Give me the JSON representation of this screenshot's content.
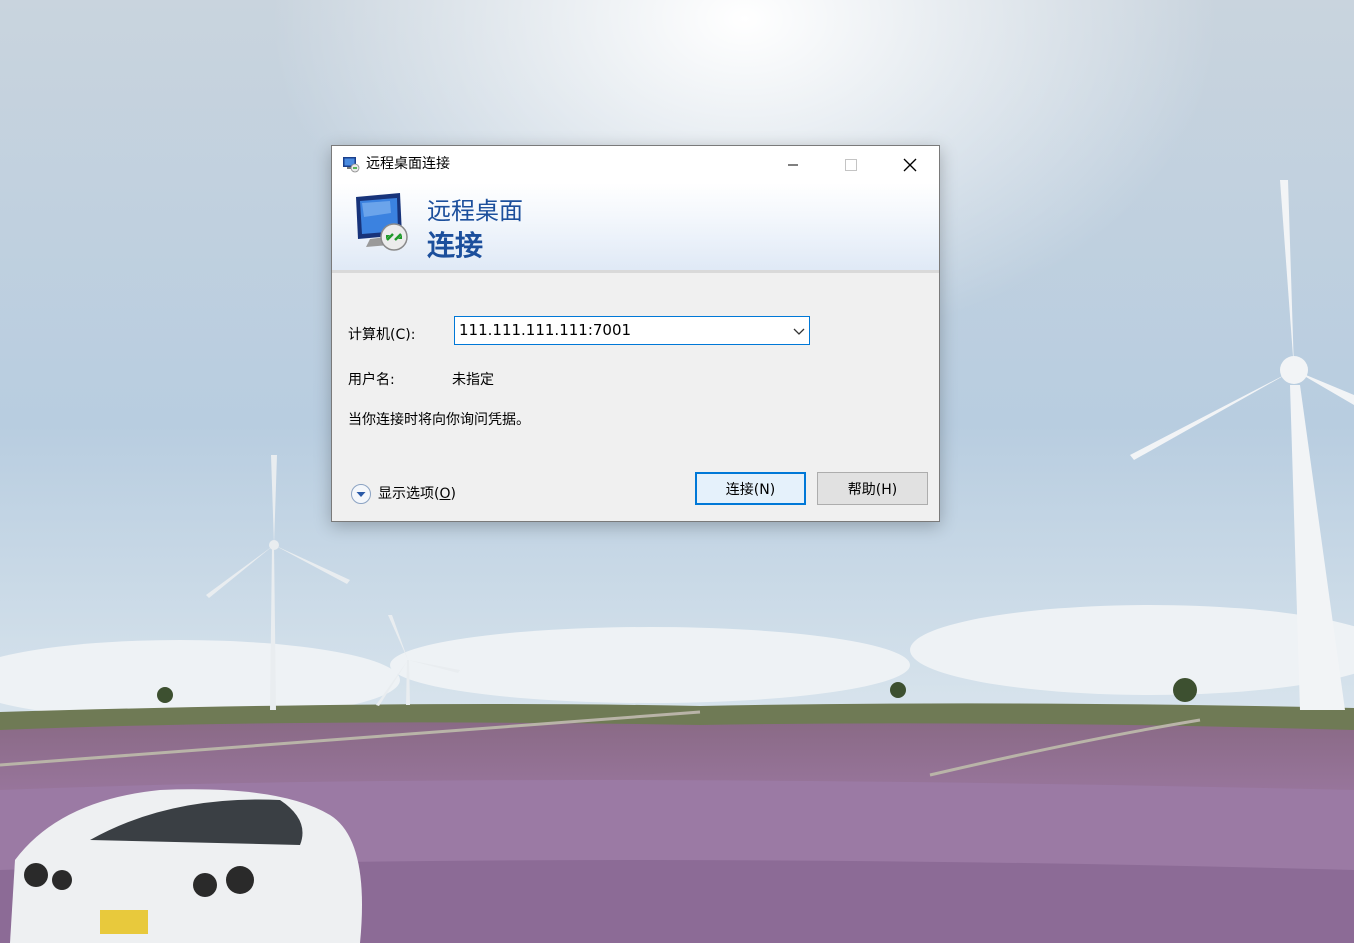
{
  "window": {
    "title": "远程桌面连接",
    "controls": {
      "minimize": "minimize",
      "maximize": "maximize",
      "close": "close"
    }
  },
  "banner": {
    "line1": "远程桌面",
    "line2": "连接"
  },
  "form": {
    "computer_label": "计算机(C):",
    "computer_value": "111.111.111.111:7001",
    "username_label": "用户名:",
    "username_value": "未指定",
    "info": "当你连接时将向你询问凭据。"
  },
  "options": {
    "label": "显示选项(",
    "accel": "O",
    "suffix": ")"
  },
  "buttons": {
    "connect": "连接(N)",
    "help": "帮助(H)"
  },
  "colors": {
    "accent": "#0078d7",
    "banner_text": "#1c4f9c"
  }
}
